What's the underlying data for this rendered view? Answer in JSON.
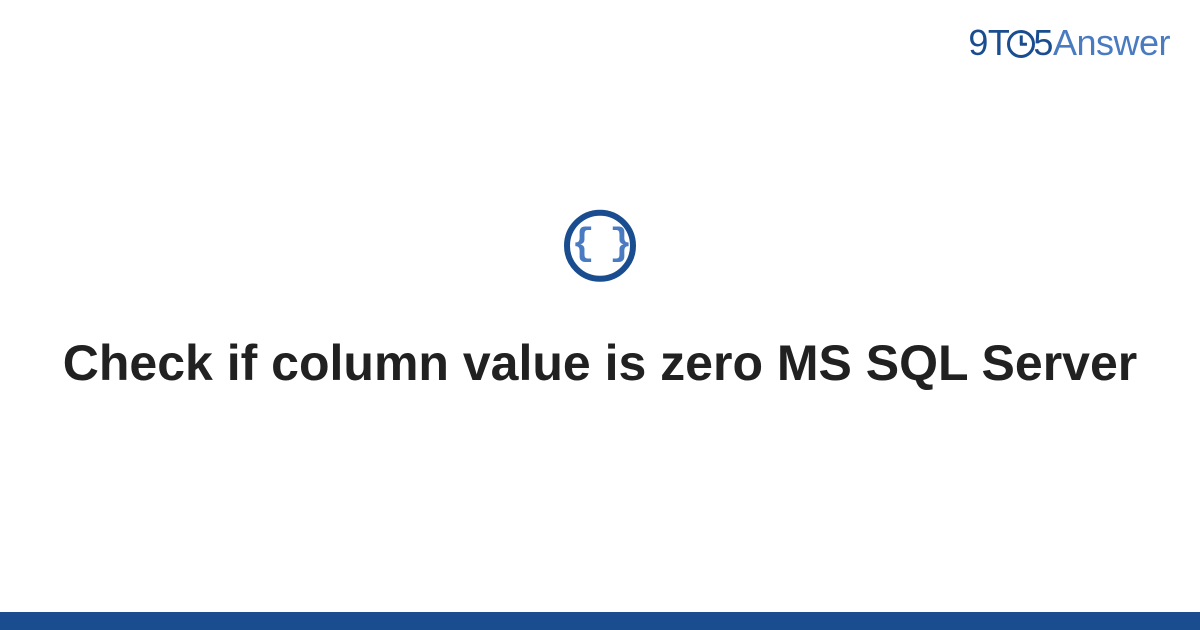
{
  "logo": {
    "part1": "9T",
    "part2": "5",
    "part3": "Answer"
  },
  "icon": {
    "content": "{ }",
    "name": "code-braces"
  },
  "title": "Check if column value is zero MS SQL Server",
  "colors": {
    "primary": "#1a4d8f",
    "secondary": "#4a7bc0"
  }
}
